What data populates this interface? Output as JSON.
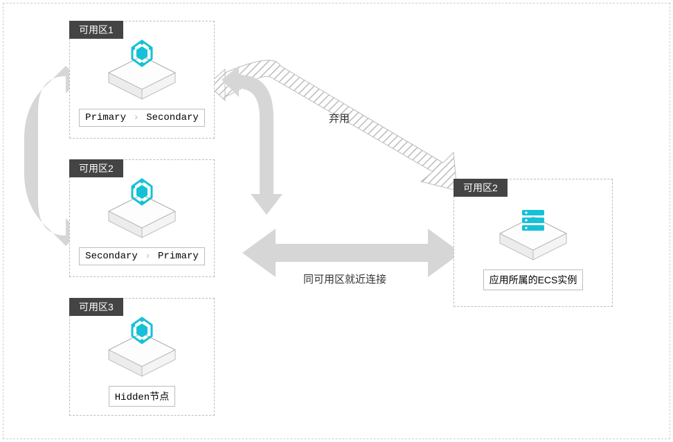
{
  "zones": {
    "z1": {
      "tab": "可用区1",
      "caption_a": "Primary",
      "caption_b": "Secondary"
    },
    "z2": {
      "tab": "可用区2",
      "caption_a": "Secondary",
      "caption_b": "Primary"
    },
    "z3": {
      "tab": "可用区3",
      "caption": "Hidden节点"
    },
    "ecs": {
      "tab": "可用区2",
      "caption": "应用所属的ECS实例"
    }
  },
  "labels": {
    "deprecated": "弃用",
    "nearby": "同可用区就近连接"
  },
  "icons": {
    "mongo": "mongo-node-icon",
    "ecs": "ecs-instance-icon"
  },
  "colors": {
    "accent": "#15c1d7",
    "arrow": "#d6d6d6",
    "tab_bg": "#444444"
  }
}
